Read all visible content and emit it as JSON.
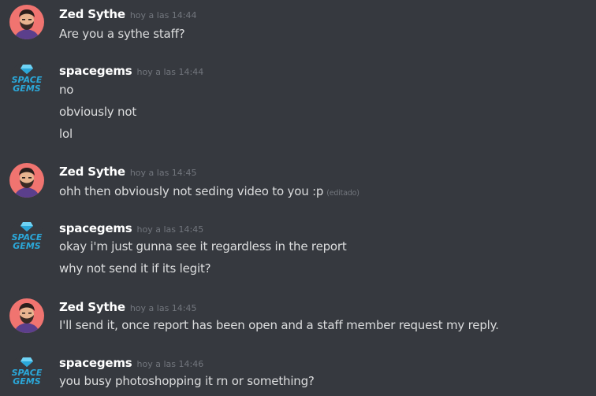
{
  "messages": [
    {
      "author": "Zed Sythe",
      "avatar": "bearded-man-avatar",
      "timestamp": "hoy a las 14:44",
      "lines": [
        {
          "text": "Are you a sythe staff?"
        }
      ]
    },
    {
      "author": "spacegems",
      "avatar": "space-gems-logo",
      "timestamp": "hoy a las 14:44",
      "lines": [
        {
          "text": "no"
        },
        {
          "text": "obviously not"
        },
        {
          "text": "lol"
        }
      ]
    },
    {
      "author": "Zed Sythe",
      "avatar": "bearded-man-avatar",
      "timestamp": "hoy a las 14:45",
      "lines": [
        {
          "text": "ohh then obviously not seding video to you :p",
          "edited": "(editado)"
        }
      ]
    },
    {
      "author": "spacegems",
      "avatar": "space-gems-logo",
      "timestamp": "hoy a las 14:45",
      "lines": [
        {
          "text": "okay i'm just gunna see it regardless in the report"
        },
        {
          "text": "why not send it if its legit?"
        }
      ]
    },
    {
      "author": "Zed Sythe",
      "avatar": "bearded-man-avatar",
      "timestamp": "hoy a las 14:45",
      "lines": [
        {
          "text": "I'll send it, once report has been open and a staff member request my reply."
        }
      ]
    },
    {
      "author": "spacegems",
      "avatar": "space-gems-logo",
      "timestamp": "hoy a las 14:46",
      "lines": [
        {
          "text": "you busy photoshopping it rn or something?"
        }
      ]
    }
  ],
  "logo_text": {
    "top": "SPACE",
    "bottom": "GEMS"
  },
  "colors": {
    "background": "#36393f",
    "username": "#ffffff",
    "message_text": "#dcddde",
    "timestamp": "#72767d",
    "zed_avatar_bg": "#f07470",
    "gems_logo": "#2ba7d8"
  }
}
